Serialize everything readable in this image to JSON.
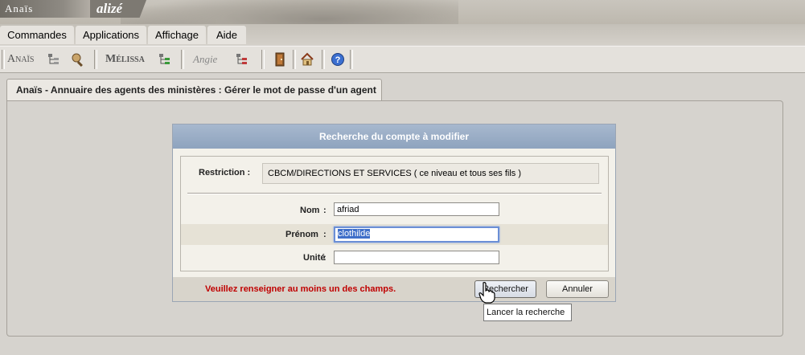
{
  "banner": {
    "logo_anais": "Anaïs",
    "logo_alize": "alizé"
  },
  "menu": {
    "items": [
      "Commandes",
      "Applications",
      "Affichage",
      "Aide"
    ]
  },
  "toolbar": {
    "anais_label": "Anaïs",
    "melissa_label": "Mélissa",
    "angie_label": "Angie",
    "icons": [
      "tree-icon",
      "search-icon",
      "tree-icon",
      "tree-icon",
      "exit-door-icon",
      "home-icon",
      "help-icon"
    ]
  },
  "tab": {
    "title": "Anaïs - Annuaire des agents des ministères : Gérer le mot de passe d'un agent"
  },
  "dialog": {
    "title": "Recherche du compte à modifier",
    "restriction_label": "Restriction :",
    "restriction_value": "CBCM/DIRECTIONS ET SERVICES ( ce niveau et tous ses fils )",
    "nom_label": "Nom",
    "nom_value": "afriad",
    "prenom_label": "Prénom",
    "prenom_value": "clothilde",
    "unite_label": "Unité",
    "unite_value": "",
    "colon": ":",
    "warning": "Veuillez renseigner au moins un des champs.",
    "search_button": "Rechercher",
    "cancel_button": "Annuler"
  },
  "tooltip": {
    "text": "Lancer la recherche"
  },
  "colors": {
    "header": "#8ea3be",
    "warning": "#c00000",
    "selection": "#3f6fc9"
  }
}
